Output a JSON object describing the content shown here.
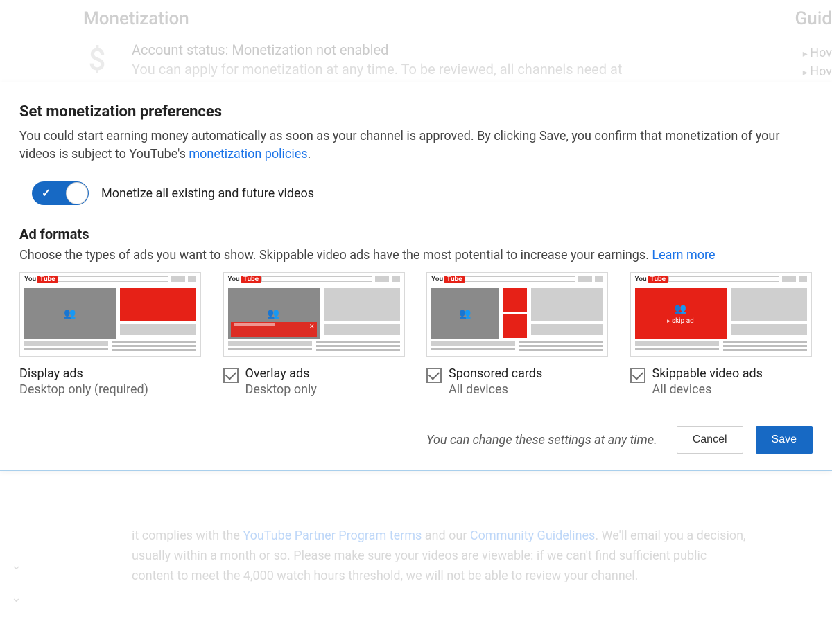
{
  "background": {
    "page_title": "Monetization",
    "right_header": "Guid",
    "dollar_icon": "$",
    "account_status": "Account status: Monetization not enabled",
    "account_sub": "You can apply for monetization at any time. To be reviewed, all channels need at",
    "right_items": [
      "Hov",
      "Hov"
    ],
    "bottom_text_pre": "it complies with the ",
    "bottom_link1": "YouTube Partner Program terms",
    "bottom_mid": " and our ",
    "bottom_link2": "Community Guidelines",
    "bottom_text_post": ". We'll email you a decision, usually within a month or so. Please make sure your videos are viewable: if we can't find sufficient public content to meet the 4,000 watch hours threshold, we will not be able to review your channel."
  },
  "modal": {
    "heading": "Set monetization preferences",
    "body_pre": "You could start earning money automatically as soon as your channel is approved. By clicking Save, you confirm that monetization of your videos is subject to YouTube's ",
    "body_link": "monetization policies",
    "body_post": ".",
    "toggle_label": "Monetize all existing and future videos",
    "toggle_on": true,
    "ad_formats_heading": "Ad formats",
    "ad_formats_body": "Choose the types of ads you want to show. Skippable video ads have the most potential to increase your earnings. ",
    "ad_formats_link": "Learn more",
    "formats": [
      {
        "title": "Display ads",
        "subtitle": "Desktop only (required)",
        "checkbox": false,
        "checked": false
      },
      {
        "title": "Overlay ads",
        "subtitle": "Desktop only",
        "checkbox": true,
        "checked": true
      },
      {
        "title": "Sponsored cards",
        "subtitle": "All devices",
        "checkbox": true,
        "checked": true
      },
      {
        "title": "Skippable video ads",
        "subtitle": "All devices",
        "checkbox": true,
        "checked": true
      }
    ],
    "skip_ad_text": "skip ad",
    "footer_note": "You can change these settings at any time.",
    "cancel_label": "Cancel",
    "save_label": "Save",
    "logo_you": "You",
    "logo_tube": "Tube"
  }
}
